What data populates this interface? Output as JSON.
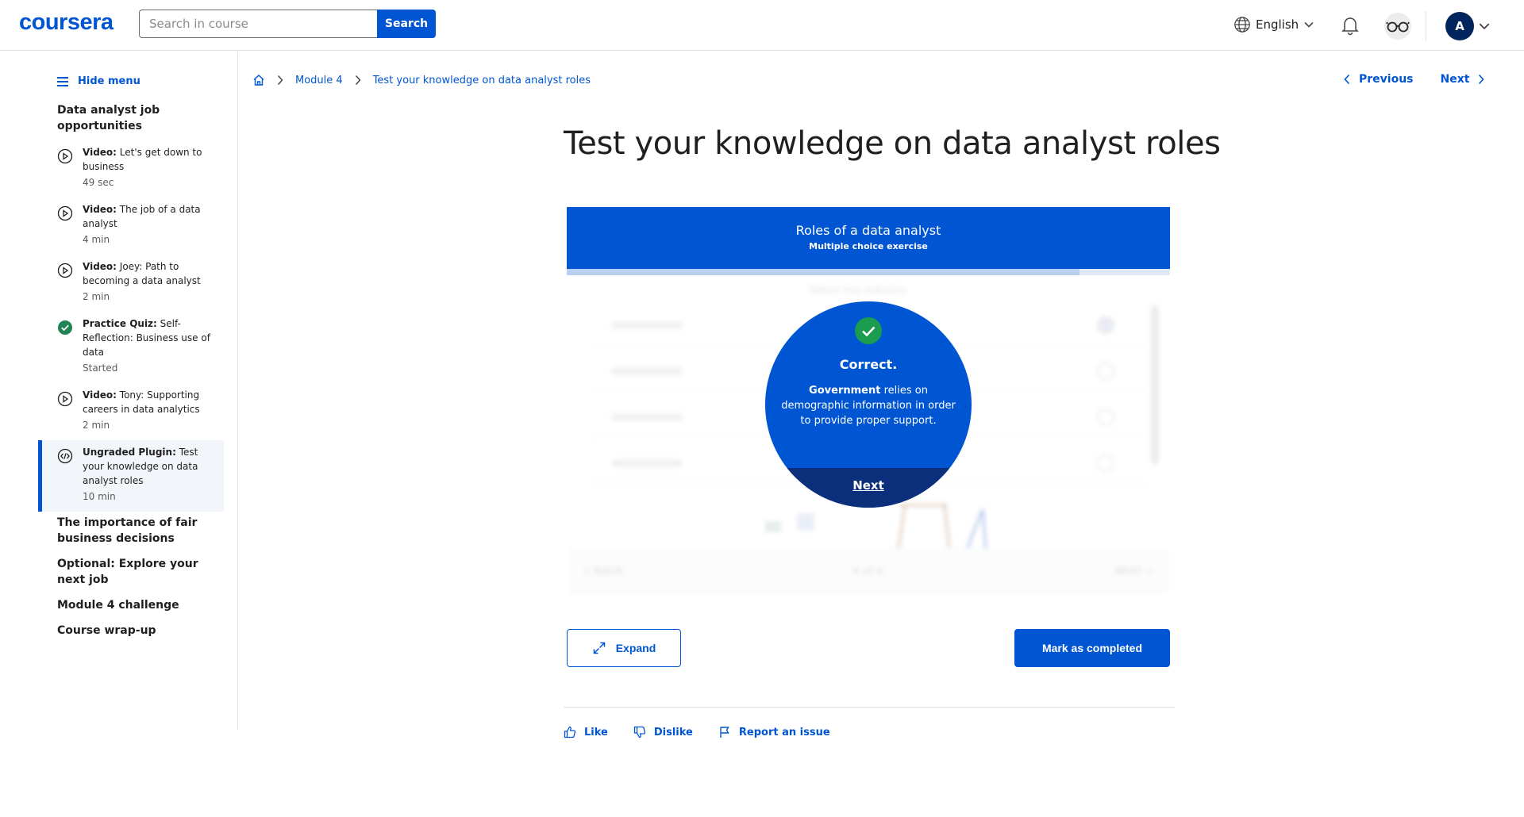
{
  "header": {
    "logo": "coursera",
    "search_placeholder": "Search in course",
    "search_button": "Search",
    "language": "English",
    "avatar_initial": "A",
    "accent_color": "#0056d2"
  },
  "sidebar": {
    "hide_menu": "Hide menu",
    "section_current": "Data analyst job opportunities",
    "items": [
      {
        "type": "Video:",
        "title": " Let's get down to business",
        "duration": "49 sec",
        "icon": "play-circle-icon"
      },
      {
        "type": "Video:",
        "title": " The job of a data analyst",
        "duration": "4 min",
        "icon": "play-circle-icon"
      },
      {
        "type": "Video:",
        "title": " Joey: Path to becoming a data analyst",
        "duration": "2 min",
        "icon": "play-circle-icon"
      },
      {
        "type": "Practice Quiz:",
        "title": " Self-Reflection: Business use of data",
        "duration": "Started",
        "icon": "check-circle-icon"
      },
      {
        "type": "Video:",
        "title": " Tony: Supporting careers in data analytics",
        "duration": "2 min",
        "icon": "play-circle-icon"
      },
      {
        "type": "Ungraded Plugin:",
        "title": " Test your knowledge on data analyst roles",
        "duration": "10 min",
        "icon": "code-icon"
      }
    ],
    "sections": [
      "The importance of fair business decisions",
      "Optional: Explore your next job",
      "Module 4 challenge",
      "Course wrap-up"
    ]
  },
  "breadcrumb": {
    "module": "Module 4",
    "current": "Test your knowledge on data analyst roles"
  },
  "pager": {
    "previous": "Previous",
    "next": "Next"
  },
  "main": {
    "title": "Test your knowledge on data analyst roles",
    "plugin": {
      "header_title": "Roles of a data analyst",
      "header_subtitle": "Multiple choice exercise",
      "question": "Select the industry",
      "back": "< BACK",
      "page": "4 of 4",
      "next": "NEXT >",
      "result_heading": "Correct.",
      "result_bold": "Government",
      "result_text": " relies on demographic information in order to provide proper support.",
      "result_next": "Next"
    },
    "expand_label": "Expand",
    "complete_label": "Mark as completed"
  },
  "feedback": {
    "like": "Like",
    "dislike": "Dislike",
    "report": "Report an issue"
  }
}
